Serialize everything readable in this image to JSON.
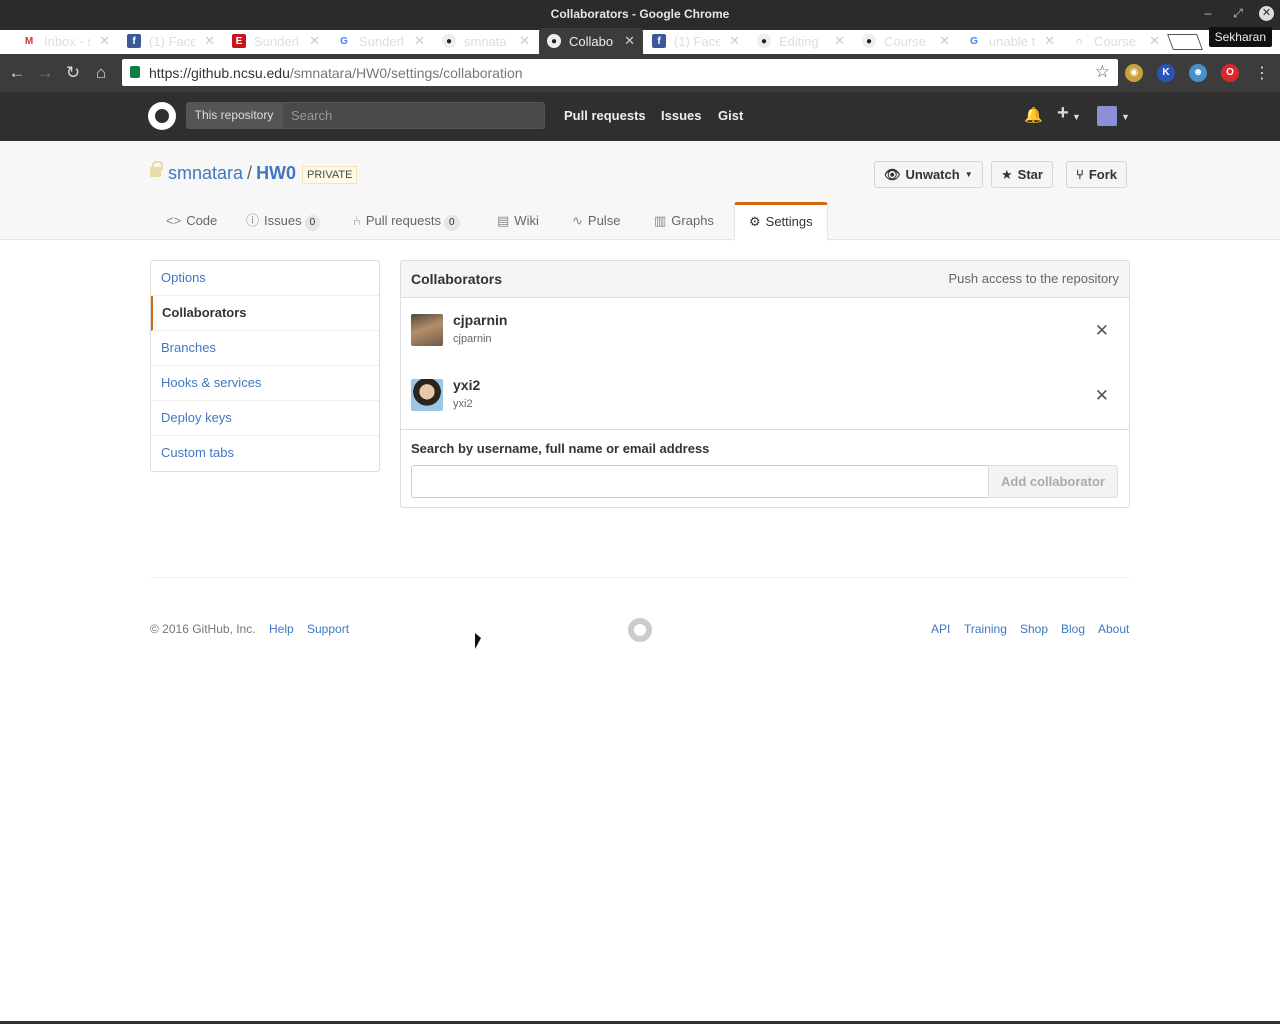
{
  "window": {
    "title": "Collaborators - Google Chrome",
    "profile": "Sekharan"
  },
  "tabs": [
    {
      "label": "Inbox - s",
      "icon": "gmail-icon"
    },
    {
      "label": "(1) Face",
      "icon": "facebook-icon"
    },
    {
      "label": "Sunderl",
      "icon": "espn-icon"
    },
    {
      "label": "Sunderl",
      "icon": "google-icon"
    },
    {
      "label": "smnata",
      "icon": "github-icon"
    },
    {
      "label": "Collabo",
      "icon": "github-icon"
    },
    {
      "label": "(1) Face",
      "icon": "facebook-icon"
    },
    {
      "label": "Editing",
      "icon": "github-icon"
    },
    {
      "label": "Course",
      "icon": "github-icon"
    },
    {
      "label": "unable t",
      "icon": "google-icon"
    },
    {
      "label": "Course",
      "icon": "coursera-icon"
    }
  ],
  "address": {
    "host": "https://github.ncsu.edu",
    "path": "/smnatara/HW0/settings/collaboration"
  },
  "header": {
    "scope_label": "This repository",
    "search_placeholder": "Search",
    "nav": [
      "Pull requests",
      "Issues",
      "Gist"
    ]
  },
  "repo": {
    "owner": "smnatara",
    "separator": "/",
    "name": "HW0",
    "visibility": "PRIVATE",
    "buttons": {
      "watch": "Unwatch",
      "star": "Star",
      "fork": "Fork"
    },
    "tabs": {
      "code": "Code",
      "issues": "Issues",
      "issues_count": "0",
      "pulls": "Pull requests",
      "pulls_count": "0",
      "wiki": "Wiki",
      "pulse": "Pulse",
      "graphs": "Graphs",
      "settings": "Settings"
    }
  },
  "settings_menu": [
    "Options",
    "Collaborators",
    "Branches",
    "Hooks & services",
    "Deploy keys",
    "Custom tabs"
  ],
  "collaborators": {
    "title": "Collaborators",
    "note": "Push access to the repository",
    "list": [
      {
        "name": "cjparnin",
        "login": "cjparnin"
      },
      {
        "name": "yxi2",
        "login": "yxi2"
      }
    ],
    "search_label": "Search by username, full name or email address",
    "add_button": "Add collaborator"
  },
  "footer": {
    "copyright": "© 2016 GitHub, Inc.",
    "left_links": [
      "Help",
      "Support"
    ],
    "right_links": [
      "API",
      "Training",
      "Shop",
      "Blog",
      "About"
    ]
  }
}
